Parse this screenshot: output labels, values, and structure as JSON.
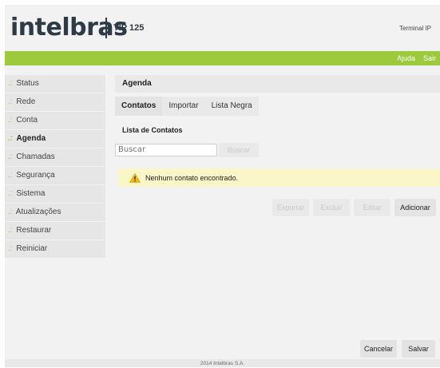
{
  "header": {
    "logo": "intelbras",
    "model": "TIP 125",
    "terminal": "Terminal IP"
  },
  "topnav": {
    "help": "Ajuda",
    "exit": "Sair"
  },
  "sidebar": {
    "prefix": ".:",
    "items": [
      {
        "label": "Status"
      },
      {
        "label": "Rede"
      },
      {
        "label": "Conta"
      },
      {
        "label": "Agenda"
      },
      {
        "label": "Chamadas"
      },
      {
        "label": "Segurança"
      },
      {
        "label": "Sistema"
      },
      {
        "label": "Atualizações"
      },
      {
        "label": "Restaurar"
      },
      {
        "label": "Reiniciar"
      }
    ]
  },
  "main": {
    "title": "Agenda",
    "tabs": [
      {
        "label": "Contatos"
      },
      {
        "label": "Importar"
      },
      {
        "label": "Lista Negra"
      }
    ],
    "section_title": "Lista de Contatos",
    "search": {
      "placeholder": "Buscar",
      "button": "Buscar"
    },
    "alert": "Nenhum contato encontrado.",
    "actions": {
      "export": "Exportar",
      "delete": "Excluir",
      "edit": "Editar",
      "add": "Adicionar"
    },
    "cancel": "Cancelar",
    "save": "Salvar"
  },
  "footer": "2014 Intelbras S.A.",
  "colors": {
    "brand_green": "#9dc93c",
    "brand_dark": "#2c3b46",
    "alert_bg": "#fbf6c8",
    "warning_icon": "#f2b705"
  },
  "icons": {
    "alert": "warning-icon"
  }
}
